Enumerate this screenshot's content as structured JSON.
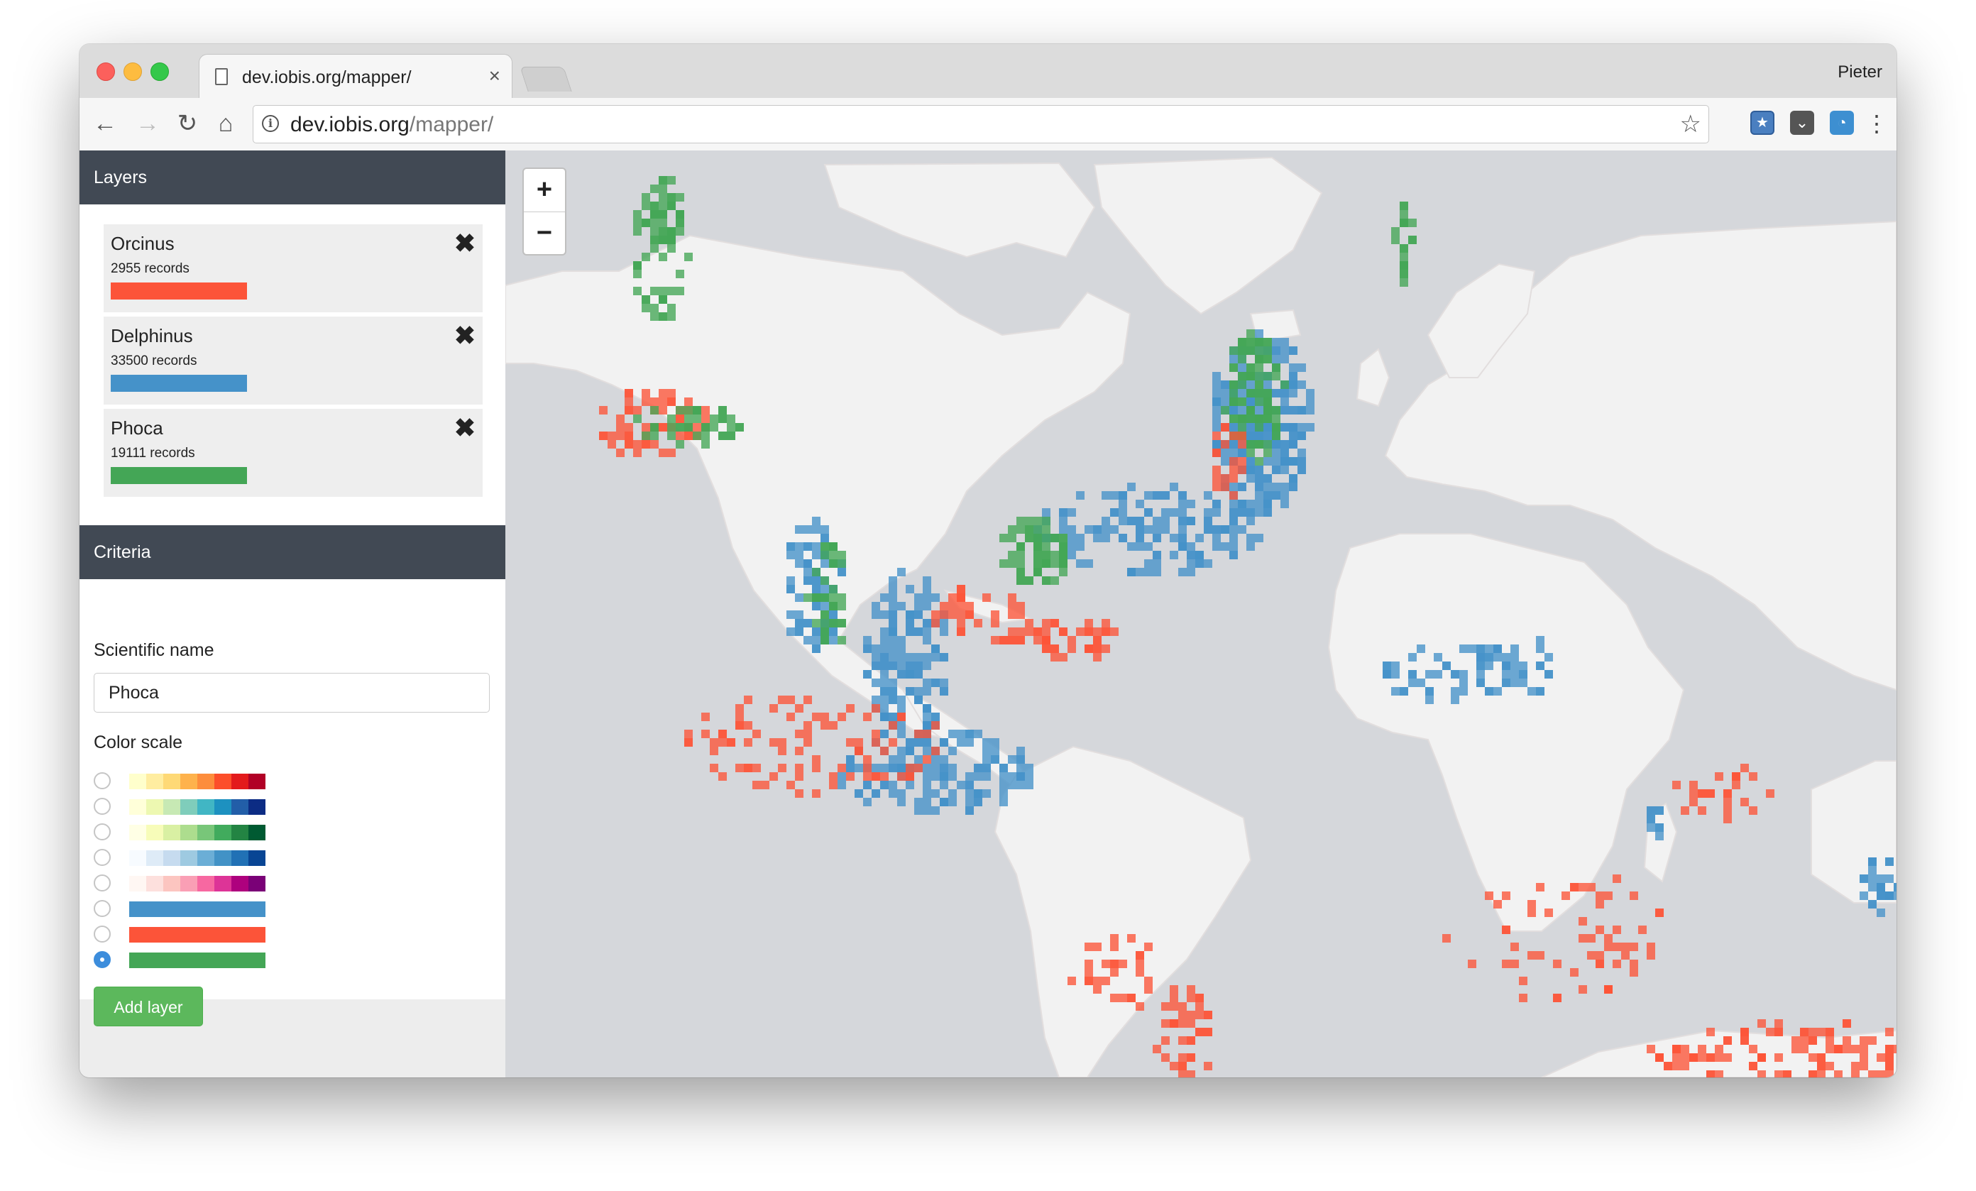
{
  "browser": {
    "tab_title": "dev.iobis.org/mapper/",
    "close_glyph": "×",
    "profile": "Pieter",
    "url_host": "dev.iobis.org",
    "url_path": "/mapper/",
    "back_glyph": "←",
    "forward_glyph": "→",
    "reload_glyph": "↻",
    "home_glyph": "⌂",
    "star_glyph": "☆",
    "menu_glyph": "⋮"
  },
  "layers_panel": {
    "title": "Layers",
    "layers": [
      {
        "name": "Orcinus",
        "records": "2955 records",
        "color": "#fc5439"
      },
      {
        "name": "Delphinus",
        "records": "33500 records",
        "color": "#4592c9"
      },
      {
        "name": "Phoca",
        "records": "19111 records",
        "color": "#44a656"
      }
    ],
    "remove_glyph": "✖"
  },
  "criteria_panel": {
    "title": "Criteria",
    "name_label": "Scientific name",
    "name_value": "Phoca",
    "scale_label": "Color scale",
    "selected_scale": 7,
    "scales": [
      [
        "#ffffcc",
        "#ffeda0",
        "#fed976",
        "#feb24c",
        "#fd8d3c",
        "#fc4e2a",
        "#e31a1c",
        "#b10026"
      ],
      [
        "#ffffd9",
        "#edf8b1",
        "#c7e9b4",
        "#7fcdbb",
        "#41b6c4",
        "#1d91c0",
        "#225ea8",
        "#0c2c84"
      ],
      [
        "#ffffe5",
        "#f7fcb9",
        "#d9f0a3",
        "#addd8e",
        "#78c679",
        "#41ab5d",
        "#238443",
        "#005a32"
      ],
      [
        "#f7fbff",
        "#deebf7",
        "#c6dbef",
        "#9ecae1",
        "#6baed6",
        "#4292c6",
        "#2171b5",
        "#084594"
      ],
      [
        "#fff7f3",
        "#fde0dd",
        "#fcc5c0",
        "#fa9fb5",
        "#f768a1",
        "#dd3497",
        "#ae017e",
        "#7a0177"
      ],
      [
        "#4592c9"
      ],
      [
        "#fc5439"
      ],
      [
        "#44a656"
      ]
    ],
    "add_label": "Add layer"
  },
  "map": {
    "zoom_in": "+",
    "zoom_out": "−",
    "ocean_color": "#d5d7db",
    "land_color": "#f2f2f2"
  }
}
